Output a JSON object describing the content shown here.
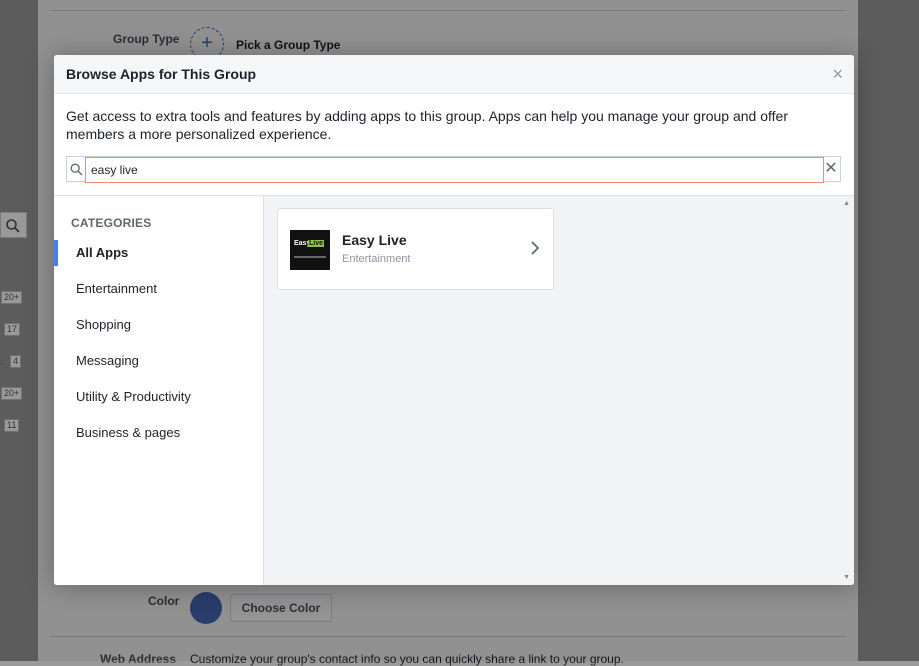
{
  "background": {
    "group_type_label": "Group Type",
    "pick_group_type": "Pick a Group Type",
    "color_label": "Color",
    "choose_color_button": "Choose Color",
    "bottom_label": "Web Address",
    "bottom_text": "Customize your group's contact info so you can quickly share a link to your group."
  },
  "left_edge": {
    "badges": [
      "20+",
      "17",
      "4",
      "20+",
      "11"
    ]
  },
  "dialog": {
    "title": "Browse Apps for This Group",
    "close_glyph": "×",
    "description": "Get access to extra tools and features by adding apps to this group. Apps can help you manage your group and offer members a more personalized experience.",
    "search": {
      "value": "easy live",
      "clear_glyph": "✕"
    },
    "categories_heading": "CATEGORIES",
    "categories": [
      {
        "label": "All Apps",
        "active": true
      },
      {
        "label": "Entertainment",
        "active": false
      },
      {
        "label": "Shopping",
        "active": false
      },
      {
        "label": "Messaging",
        "active": false
      },
      {
        "label": "Utility & Productivity",
        "active": false
      },
      {
        "label": "Business & pages",
        "active": false
      }
    ],
    "results": [
      {
        "name": "Easy Live",
        "category": "Entertainment",
        "logo_text_1": "Easy",
        "logo_text_2": "Live",
        "logo_accent_color": "#8bc34a",
        "icon": "chevron-right-icon"
      }
    ]
  },
  "colors": {
    "accent": "#4267b2",
    "active_indicator": "#4080ff",
    "input_focus_border": "#f28b6a"
  }
}
